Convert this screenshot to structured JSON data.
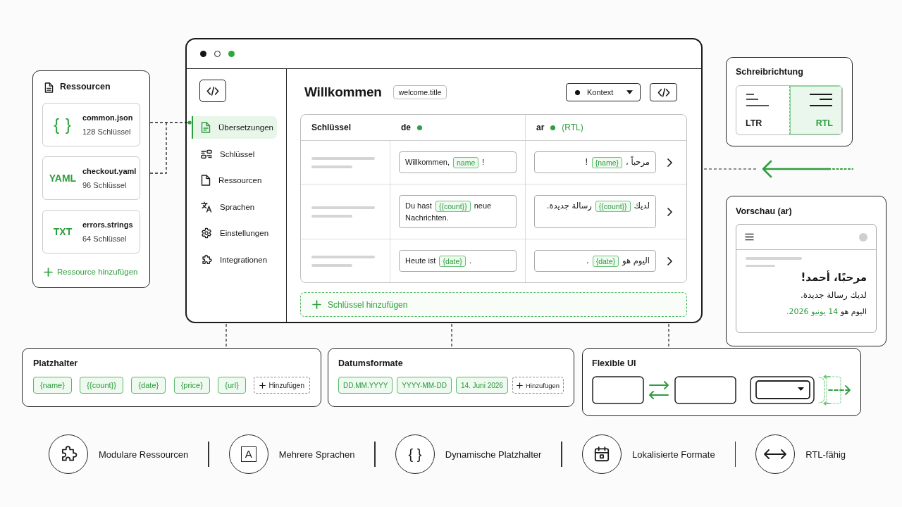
{
  "resources": {
    "title": "Ressourcen",
    "files": [
      {
        "kind": "glyph",
        "badge": "{ }",
        "name": "common.json",
        "count": "128 Schlüssel"
      },
      {
        "kind": "label",
        "badge": "YAML",
        "name": "checkout.yaml",
        "count": "96 Schlüssel"
      },
      {
        "kind": "label",
        "badge": "TXT",
        "name": "errors.strings",
        "count": "64 Schlüssel"
      }
    ],
    "add_label": "Ressource hinzufügen"
  },
  "window": {
    "controls": [
      {
        "kind": "filled",
        "color": "#151515"
      },
      {
        "kind": "outline",
        "color": "#ffffff"
      },
      {
        "kind": "filled",
        "color": "#2ea641"
      }
    ]
  },
  "sidebar": {
    "items": [
      {
        "label": "Übersetzungen",
        "selected": true
      },
      {
        "label": "Schlüssel",
        "selected": false
      },
      {
        "label": "Ressourcen",
        "selected": false
      },
      {
        "label": "Sprachen",
        "selected": false
      },
      {
        "label": "Einstellungen",
        "selected": false
      },
      {
        "label": "Integrationen",
        "selected": false
      }
    ]
  },
  "editor": {
    "title": "Willkommen",
    "key_badge": "welcome.title",
    "context_dropdown": "Kontext",
    "table": {
      "key_column": "Schlüssel",
      "languages": [
        {
          "code": "de",
          "active": true,
          "rtl": false
        },
        {
          "code": "ar",
          "active": true,
          "rtl": true,
          "note": "(RTL)"
        }
      ],
      "rows": [
        {
          "cells": [
            {
              "parts": [
                {
                  "kind": "text",
                  "text": "Willkommen,"
                },
                {
                  "kind": "placeholder",
                  "text": "name"
                },
                {
                  "kind": "text",
                  "text": "!"
                }
              ]
            },
            {
              "parts": [
                {
                  "kind": "text",
                  "text": "مرحباً ،"
                },
                {
                  "kind": "placeholder",
                  "text": "{name}"
                },
                {
                  "kind": "text",
                  "text": "!"
                }
              ]
            }
          ]
        },
        {
          "cells": [
            {
              "parts": [
                {
                  "kind": "text",
                  "text": "Du hast"
                },
                {
                  "kind": "placeholder",
                  "text": "{{count}}"
                },
                {
                  "kind": "text",
                  "text": "neue Nachrichten."
                }
              ]
            },
            {
              "parts": [
                {
                  "kind": "text",
                  "text": "لديك"
                },
                {
                  "kind": "placeholder",
                  "text": "{{count}}"
                },
                {
                  "kind": "text",
                  "text": "رسالة جديدة."
                }
              ]
            }
          ]
        },
        {
          "cells": [
            {
              "parts": [
                {
                  "kind": "text",
                  "text": "Heute ist"
                },
                {
                  "kind": "placeholder",
                  "text": "{date}"
                },
                {
                  "kind": "text",
                  "text": "."
                }
              ]
            },
            {
              "parts": [
                {
                  "kind": "text",
                  "text": "اليوم هو"
                },
                {
                  "kind": "placeholder",
                  "text": "{date}"
                },
                {
                  "kind": "text",
                  "text": "."
                }
              ]
            }
          ]
        }
      ]
    },
    "add_key": "Schlüssel hinzufügen"
  },
  "writing_direction": {
    "title": "Schreibrichtung",
    "options": [
      {
        "label": "LTR",
        "selected": false
      },
      {
        "label": "RTL",
        "selected": true
      }
    ]
  },
  "preview": {
    "title": "Vorschau (ar)",
    "greeting": "مرحبًا، أحمد!",
    "message": "لديك رسالة جديدة.",
    "date_line": {
      "text": "اليوم هو",
      "highlight": "14 يونيو 2026."
    }
  },
  "placeholders": {
    "title": "Platzhalter",
    "chips": [
      "{name}",
      "{{count}}",
      "{date}",
      "{price}",
      "{url}"
    ],
    "add_label": "Hinzufügen"
  },
  "date_formats": {
    "title": "Datumsformate",
    "chips": [
      "DD.MM.YYYY",
      "YYYY-MM-DD",
      "14. Juni 2026"
    ],
    "add_label": "Hinzufügen"
  },
  "flexible_ui": {
    "title": "Flexible UI"
  },
  "features": [
    {
      "label": "Modulare Ressourcen"
    },
    {
      "label": "Mehrere Sprachen",
      "glyph": "A"
    },
    {
      "label": "Dynamische Platzhalter",
      "glyph": "{ }"
    },
    {
      "label": "Lokalisierte Formate"
    },
    {
      "label": "RTL-fähig"
    }
  ]
}
